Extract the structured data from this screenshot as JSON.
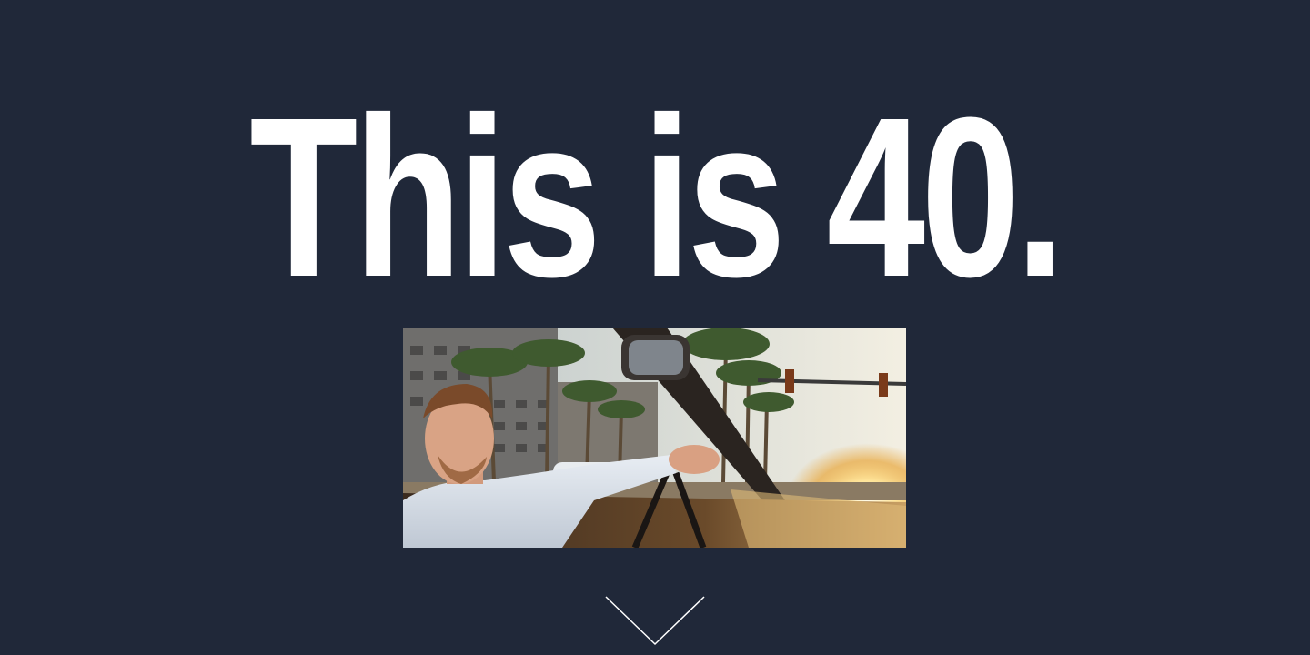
{
  "hero": {
    "headline": "This is 40."
  },
  "photo": {
    "alt": ""
  },
  "scroll": {
    "icon": "chevron-down-icon"
  },
  "colors": {
    "background": "#202839",
    "headline": "#ffffff",
    "chevron": "#ffffff"
  }
}
